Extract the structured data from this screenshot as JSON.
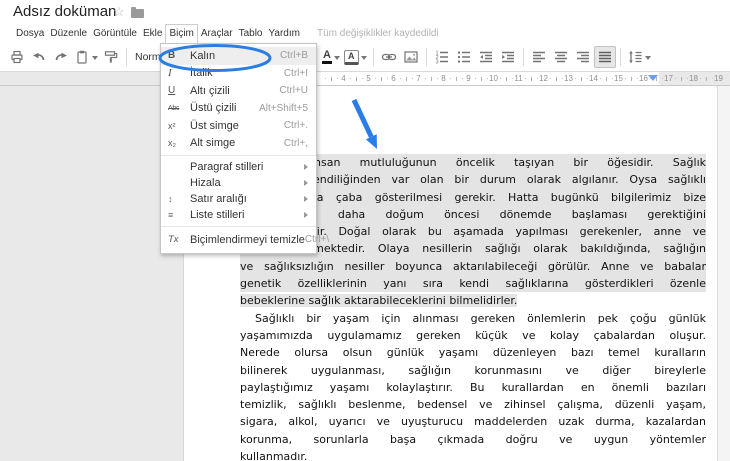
{
  "accent_color": "#2b7ce9",
  "titlebar": {
    "title": "Adsız doküman",
    "star_icon": "☆"
  },
  "menubar": {
    "items": [
      "Dosya",
      "Düzenle",
      "Görüntüle",
      "Ekle",
      "Biçim",
      "Araçlar",
      "Tablo",
      "Yardım"
    ],
    "active_item": "Biçim",
    "status": "Tüm değişiklikler kaydedildi"
  },
  "toolbar": {
    "style_selector": "Normal m...",
    "icons": [
      "print-icon",
      "undo-icon",
      "redo-icon",
      "paste-icon",
      "paint-format-icon",
      "text-color-icon",
      "highlight-color-icon",
      "insert-link-icon",
      "insert-image-icon",
      "numbered-list-icon",
      "bulleted-list-icon",
      "decrease-indent-icon",
      "increase-indent-icon",
      "align-left-icon",
      "align-center-icon",
      "align-right-icon",
      "justify-icon",
      "line-spacing-icon"
    ],
    "active_icon": "justify-icon"
  },
  "format_menu": {
    "items": [
      {
        "icon": "bold-icon",
        "glyph": "B",
        "label": "Kalın",
        "shortcut": "Ctrl+B",
        "annotated": true
      },
      {
        "icon": "italic-icon",
        "glyph": "I",
        "label": "İtalik",
        "shortcut": "Ctrl+I"
      },
      {
        "icon": "underline-icon",
        "glyph": "U",
        "label": "Altı çizili",
        "shortcut": "Ctrl+U"
      },
      {
        "icon": "strikethrough-icon",
        "glyph": "Abc",
        "label": "Üstü çizili",
        "shortcut": "Alt+Shift+5"
      },
      {
        "icon": "superscript-icon",
        "glyph": "x²",
        "label": "Üst simge",
        "shortcut": "Ctrl+."
      },
      {
        "icon": "subscript-icon",
        "glyph": "x₂",
        "label": "Alt simge",
        "shortcut": "Ctrl+,"
      },
      {
        "label": "Paragraf stilleri",
        "submenu": true
      },
      {
        "label": "Hizala",
        "submenu": true
      },
      {
        "icon": "line-spacing-icon",
        "glyph": "↕",
        "label": "Satır aralığı",
        "submenu": true
      },
      {
        "icon": "list-styles-icon",
        "glyph": "≡",
        "label": "Liste stilleri",
        "submenu": true
      },
      {
        "icon": "clear-formatting-icon",
        "glyph": "Tx",
        "label": "Biçimlendirmeyi temizle",
        "shortcut": "Ctrl+\\"
      }
    ]
  },
  "ruler": {
    "numbers": [
      4,
      5,
      6,
      7,
      8,
      9,
      10,
      11,
      12,
      13,
      14,
      15,
      16,
      17,
      18,
      19
    ]
  },
  "document": {
    "para1_lines": [
      "Sağlık, insan mutluluğunun öncelik taşıyan bir öğesidir. Sağlık",
      "çoğu kez kendiliğinden var olan bir durum olarak algılanır. Oysa sağlıklı",
      "olma yolunda çaba gösterilmesi gerekir. Hatta bugünkü bilgilerimiz bize",
      "bu çabanın daha doğum öncesi dönemde başlaması gerektiğini",
      "göstermektedir. Doğal olarak bu aşamada yapılması gerekenler, anne ve",
      "babaya düşmektedir. Olaya nesillerin sağlığı olarak bakıldığında, sağlığın",
      "ve sağlıksızlığın nesiller boyunca aktarılabileceği görülür. Anne ve babalar",
      "genetik özelliklerinin yanı sıra kendi sağlıklarına gösterdikleri özenle"
    ],
    "para1_last": "bebeklerine sağlık aktarabileceklerini bilmelidirler.",
    "para2_lines": [
      "Sağlıklı bir yaşam için alınması gereken önlemlerin pek çoğu günlük",
      "yaşamımızda  uygulamamız gereken küçük ve kolay çabalardan oluşur.",
      "Nerede olursa olsun günlük yaşamı düzenleyen bazı temel kuralların",
      "bilinerek uygulanması, sağlığın korunmasını ve diğer bireylerle",
      "paylaştığımız yaşamı kolaylaştırır. Bu kurallardan en önemli bazıları",
      "temizlik, sağlıklı beslenme, bedensel ve zihinsel çalışma, düzenli yaşam,",
      "sigara, alkol, uyarıcı ve uyuşturucu maddelerden uzak durma, kazalardan",
      "korunma, sorunlarla başa çıkmada doğru ve uygun yöntemler"
    ],
    "para2_last": "kullanmadır."
  }
}
